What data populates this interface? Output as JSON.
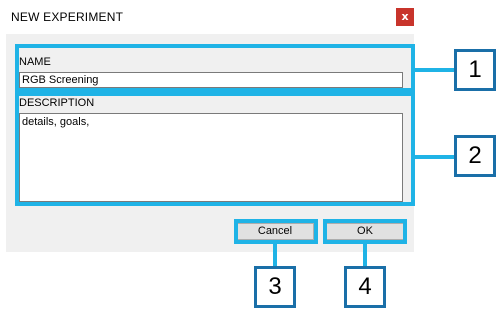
{
  "dialog": {
    "title": "NEW EXPERIMENT",
    "close_glyph": "x"
  },
  "form": {
    "name_label": "NAME",
    "name_value": "RGB Screening",
    "description_label": "DESCRIPTION",
    "description_value": "details, goals,"
  },
  "buttons": {
    "cancel_label": "Cancel",
    "ok_label": "OK"
  },
  "callouts": [
    "1",
    "2",
    "3",
    "4"
  ],
  "colors": {
    "highlight": "#1fb3e6",
    "callout_border": "#1a6fa8",
    "close_button": "#c8342b"
  }
}
